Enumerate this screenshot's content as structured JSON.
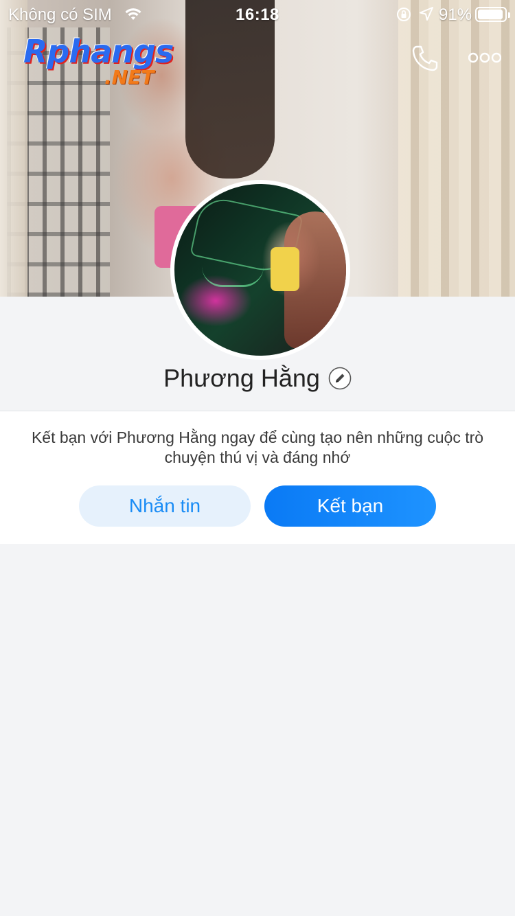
{
  "status_bar": {
    "carrier": "Không có SIM",
    "time": "16:18",
    "battery_percent": "91%",
    "battery_level": 0.91
  },
  "watermark": {
    "brand": "Rphangs",
    "suffix": ".NET"
  },
  "header_actions": {
    "call_icon": "phone-icon",
    "more_icon": "more-icon"
  },
  "profile": {
    "name": "Phương Hằng",
    "edit_icon": "pencil-icon"
  },
  "friend_prompt": {
    "message": "Kết bạn với Phương Hằng ngay để cùng tạo nên những cuộc trò chuyện thú vị và đáng nhớ",
    "message_button_label": "Nhắn tin",
    "add_friend_button_label": "Kết bạn"
  },
  "colors": {
    "accent": "#0a7af5",
    "secondary_button_bg": "#e6f1fc",
    "page_bg": "#f3f4f6"
  }
}
